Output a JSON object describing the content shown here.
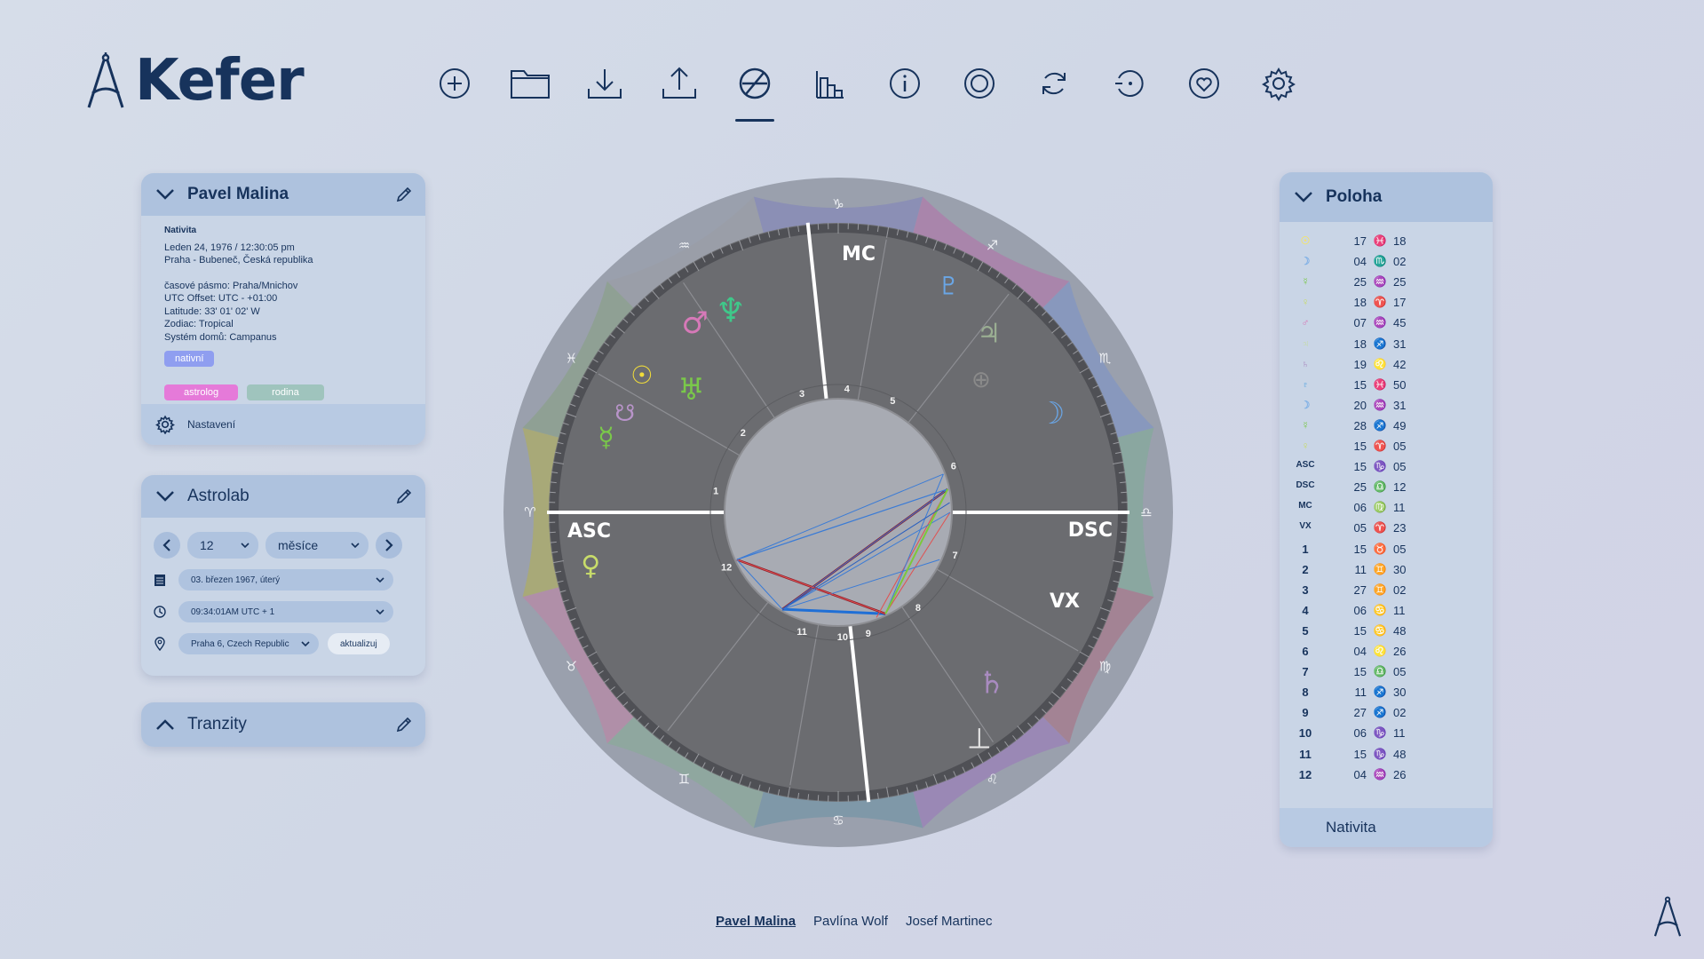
{
  "app": {
    "name": "Kefer"
  },
  "toolbar": [
    {
      "icon": "plus-circle-icon",
      "active": false
    },
    {
      "icon": "folder-icon",
      "active": false
    },
    {
      "icon": "download-icon",
      "active": false
    },
    {
      "icon": "upload-icon",
      "active": false
    },
    {
      "icon": "chart-wheel-icon",
      "active": true
    },
    {
      "icon": "bar-chart-icon",
      "active": false
    },
    {
      "icon": "info-icon",
      "active": false
    },
    {
      "icon": "target-icon",
      "active": false
    },
    {
      "icon": "refresh-icon",
      "active": false
    },
    {
      "icon": "rotate-target-icon",
      "active": false
    },
    {
      "icon": "heart-icon",
      "active": false
    },
    {
      "icon": "gear-icon",
      "active": false
    }
  ],
  "person": {
    "name": "Pavel Malina",
    "chart_type": "Nativita",
    "date_time": "Leden 24, 1976 / 12:30:05 pm",
    "place": "Praha - Bubeneč, Česká republika",
    "timezone": "časové pásmo: Praha/Mnichov",
    "utc_offset": "UTC Offset: UTC - +01:00",
    "latitude": "Latitude: 33' 01' 02' W",
    "zodiac": "Zodiac: Tropical",
    "house_system": "Systém domů: Campanus",
    "tags": [
      {
        "label": "nativní",
        "color": "#8f9ef0"
      },
      {
        "label": "astrolog",
        "color": "#e57ad9"
      },
      {
        "label": "rodina",
        "color": "#9fc4bd"
      }
    ],
    "settings_label": "Nastavení"
  },
  "astrolab": {
    "title": "Astrolab",
    "step_value": "12",
    "unit_value": "měsíce",
    "date_value": "03. březen 1967, úterý",
    "time_value": "09:34:01AM  UTC + 1",
    "place_value": "Praha 6, Czech Republic",
    "update_label": "aktualizuj"
  },
  "transits": {
    "title": "Tranzity"
  },
  "chart": {
    "labels": {
      "asc": "ASC",
      "dsc": "DSC",
      "mc": "MC",
      "vx": "VX"
    },
    "houses": [
      "1",
      "2",
      "3",
      "4",
      "5",
      "6",
      "7",
      "8",
      "9",
      "10",
      "11",
      "12"
    ],
    "sign_glyphs": [
      "♑",
      "♐",
      "♏",
      "♎",
      "♍",
      "♌",
      "♋",
      "♊",
      "♉",
      "♈",
      "♓",
      "♒"
    ],
    "sign_colors": [
      "#8b8fb5",
      "#a985ab",
      "#8898bd",
      "#8aa7a0",
      "#a38394",
      "#9a88b5",
      "#7f98a8",
      "#8fa79f",
      "#b08fa8",
      "#a8a978",
      "#8fa094",
      "#9a9ea8"
    ],
    "planets": [
      {
        "glyph": "☉",
        "color": "#f0dc3a"
      },
      {
        "glyph": "☋",
        "color": "#b894c9"
      },
      {
        "glyph": "☿",
        "color": "#7ac84a"
      },
      {
        "glyph": "♂",
        "color": "#d679b8"
      },
      {
        "glyph": "♆",
        "color": "#3fc88a"
      },
      {
        "glyph": "♅",
        "color": "#7ac84a"
      },
      {
        "glyph": "♇",
        "color": "#6aa6e6"
      },
      {
        "glyph": "♃",
        "color": "#9aae92"
      },
      {
        "glyph": "⊕",
        "color": "#8a8a8a"
      },
      {
        "glyph": "☽",
        "color": "#6aa6e6"
      },
      {
        "glyph": "♀",
        "color": "#c8dc6a"
      },
      {
        "glyph": "♄",
        "color": "#a98bc0"
      },
      {
        "glyph": "⊥",
        "color": "#e8e8e8"
      }
    ]
  },
  "positions": {
    "title": "Poloha",
    "rows": [
      {
        "sym": "☉",
        "sym_color": "#f0e276",
        "deg": "17",
        "sign": "♓",
        "sign_color": "#58a6e0",
        "min": "18"
      },
      {
        "sym": "☽",
        "sym_color": "#7fb0e6",
        "deg": "04",
        "sign": "♏",
        "sign_color": "#d679b8",
        "min": "02"
      },
      {
        "sym": "☿",
        "sym_color": "#7ac84a",
        "deg": "25",
        "sign": "♒",
        "sign_color": "#e8b84a",
        "min": "25"
      },
      {
        "sym": "♀",
        "sym_color": "#c8dc6a",
        "deg": "18",
        "sign": "♈",
        "sign_color": "#d679b8",
        "min": "17"
      },
      {
        "sym": "♂",
        "sym_color": "#d679b8",
        "deg": "07",
        "sign": "♒",
        "sign_color": "#e8b84a",
        "min": "45"
      },
      {
        "sym": "♃",
        "sym_color": "#c4dc9a",
        "deg": "18",
        "sign": "♐",
        "sign_color": "#7ac84a",
        "min": "31"
      },
      {
        "sym": "♄",
        "sym_color": "#a98bc0",
        "deg": "19",
        "sign": "♌",
        "sign_color": "#e8a84a",
        "min": "42"
      },
      {
        "sym": "♇",
        "sym_color": "#58a6e0",
        "deg": "15",
        "sign": "♓",
        "sign_color": "#58a6e0",
        "min": "50"
      },
      {
        "sym": "☽",
        "sym_color": "#7fb0e6",
        "deg": "20",
        "sign": "♒",
        "sign_color": "#e8b84a",
        "min": "31"
      },
      {
        "sym": "☿",
        "sym_color": "#7ac84a",
        "deg": "28",
        "sign": "♐",
        "sign_color": "#7ac84a",
        "min": "49"
      },
      {
        "sym": "♀",
        "sym_color": "#c8dc6a",
        "deg": "15",
        "sign": "♈",
        "sign_color": "#d679b8",
        "min": "05"
      },
      {
        "sym": "ASC",
        "sym_color": "#17335c",
        "deg": "15",
        "sign": "♑",
        "sign_color": "#7ac84a",
        "min": "05"
      },
      {
        "sym": "DSC",
        "sym_color": "#17335c",
        "deg": "25",
        "sign": "♎",
        "sign_color": "#c8dc6a",
        "min": "12"
      },
      {
        "sym": "MC",
        "sym_color": "#17335c",
        "deg": "06",
        "sign": "♍",
        "sign_color": "#a98bc0",
        "min": "11"
      },
      {
        "sym": "VX",
        "sym_color": "#17335c",
        "deg": "05",
        "sign": "♈",
        "sign_color": "#d679b8",
        "min": "23"
      },
      {
        "sym": "1",
        "sym_color": "#17335c",
        "deg": "15",
        "sign": "♉",
        "sign_color": "#d679b8",
        "min": "05"
      },
      {
        "sym": "2",
        "sym_color": "#17335c",
        "deg": "11",
        "sign": "♊",
        "sign_color": "#58a6e0",
        "min": "30"
      },
      {
        "sym": "3",
        "sym_color": "#17335c",
        "deg": "27",
        "sign": "♊",
        "sign_color": "#58a6e0",
        "min": "02"
      },
      {
        "sym": "4",
        "sym_color": "#17335c",
        "deg": "06",
        "sign": "♋",
        "sign_color": "#3fa878",
        "min": "11"
      },
      {
        "sym": "5",
        "sym_color": "#17335c",
        "deg": "15",
        "sign": "♋",
        "sign_color": "#3fa878",
        "min": "48"
      },
      {
        "sym": "6",
        "sym_color": "#17335c",
        "deg": "04",
        "sign": "♌",
        "sign_color": "#e8a84a",
        "min": "26"
      },
      {
        "sym": "7",
        "sym_color": "#17335c",
        "deg": "15",
        "sign": "♎",
        "sign_color": "#c8dc6a",
        "min": "05"
      },
      {
        "sym": "8",
        "sym_color": "#17335c",
        "deg": "11",
        "sign": "♐",
        "sign_color": "#7ac84a",
        "min": "30"
      },
      {
        "sym": "9",
        "sym_color": "#17335c",
        "deg": "27",
        "sign": "♐",
        "sign_color": "#7ac84a",
        "min": "02"
      },
      {
        "sym": "10",
        "sym_color": "#17335c",
        "deg": "06",
        "sign": "♑",
        "sign_color": "#7ac84a",
        "min": "11"
      },
      {
        "sym": "11",
        "sym_color": "#17335c",
        "deg": "15",
        "sign": "♑",
        "sign_color": "#7ac84a",
        "min": "48"
      },
      {
        "sym": "12",
        "sym_color": "#17335c",
        "deg": "04",
        "sign": "♒",
        "sign_color": "#e8b84a",
        "min": "26"
      }
    ],
    "footer": "Nativita"
  },
  "people": [
    "Pavel Malina",
    "Pavlína Wolf",
    "Josef Martinec"
  ]
}
